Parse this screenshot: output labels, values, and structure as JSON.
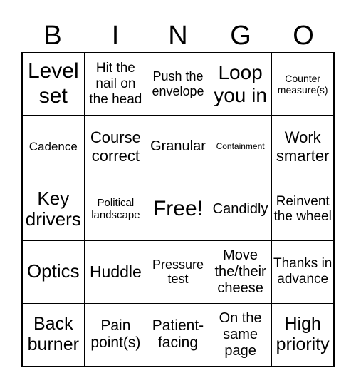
{
  "header": [
    "B",
    "I",
    "N",
    "G",
    "O"
  ],
  "cells": [
    "Level set",
    "Hit the nail on the head",
    "Push the envelope",
    "Loop you in",
    "Counter measure(s)",
    "Cadence",
    "Course correct",
    "Granular",
    "Containment",
    "Work smarter",
    "Key drivers",
    "Political landscape",
    "Free!",
    "Candidly",
    "Reinvent the wheel",
    "Optics",
    "Huddle",
    "Pressure test",
    "Move the/their cheese",
    "Thanks in advance",
    "Back burner",
    "Pain point(s)",
    "Patient-facing",
    "On the same page",
    "High priority"
  ]
}
